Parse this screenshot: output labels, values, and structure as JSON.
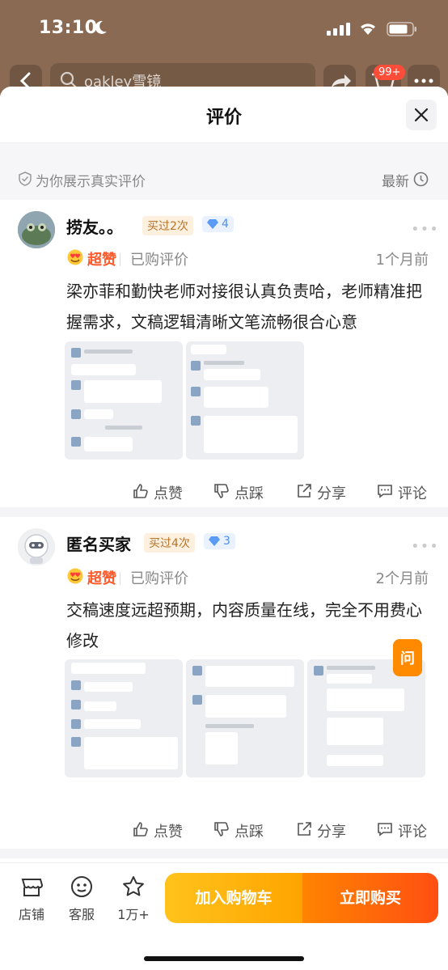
{
  "status_bar": {
    "time": "13:10"
  },
  "background_page": {
    "search_text": "oakley雪镜",
    "cart_badge": "99+"
  },
  "sheet": {
    "title": "评价",
    "verified_label": "为你展示真实评价",
    "sort_label": "最新"
  },
  "reviews": [
    {
      "username": "捞友。。",
      "bought_tag": "买过2次",
      "level": "4",
      "rating_label": "超赞",
      "purchased_label": "已购评价",
      "date": "1个月前",
      "content": "梁亦菲和勤快老师对接很认真负责哈，老师精准把握需求，文稿逻辑清晰文笔流畅很合心意",
      "photos": 2
    },
    {
      "username": "匿名买家",
      "bought_tag": "买过4次",
      "level": "3",
      "rating_label": "超赞",
      "purchased_label": "已购评价",
      "date": "2个月前",
      "content": "交稿速度远超预期，内容质量在线，完全不用费心修改",
      "photos": 3
    }
  ],
  "actions": {
    "like": "点赞",
    "dislike": "点踩",
    "share": "分享",
    "comment": "评论"
  },
  "ask_button": "问",
  "bottom_bar": {
    "shop": "店铺",
    "service": "客服",
    "favorites": "1万+",
    "add_to_cart": "加入购物车",
    "buy_now": "立即购买"
  },
  "colors": {
    "accent_orange": "#ff5a2b",
    "cart_yellow": "#ffb300",
    "buy_orange": "#ff5c10"
  }
}
